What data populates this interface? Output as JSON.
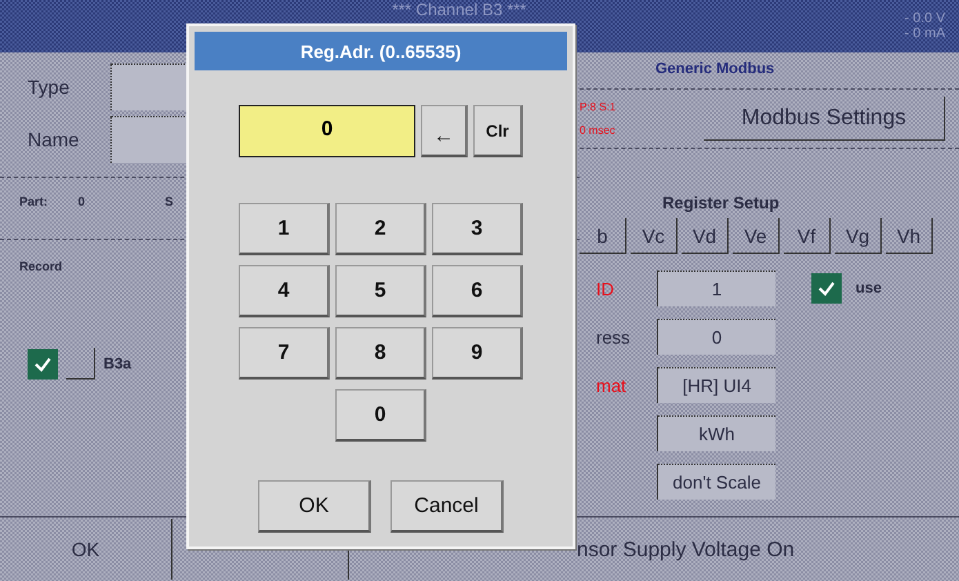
{
  "screen": {
    "title": "*** Channel B3 ***",
    "readings": [
      "- 0.0 V",
      "- 0 mA"
    ],
    "type_label": "Type",
    "name_label": "Name",
    "part_label": "Part:",
    "part_value": "0",
    "part_cut": "S",
    "record_label": "Record",
    "record_channel": {
      "label": "B3a",
      "checked": true
    },
    "sensor_type": "Generic Modbus",
    "info_lines": [
      "P:8 S:1",
      "0 msec"
    ],
    "modbus_settings": "Modbus Settings",
    "register_setup": "Register Setup",
    "register_tabs": [
      "b",
      "Vc",
      "Vd",
      "Ve",
      "Vf",
      "Vg",
      "Vh"
    ],
    "fields": [
      {
        "label": "ID",
        "highlighted": true,
        "value": "1"
      },
      {
        "label": "ress",
        "highlighted": false,
        "value": "0"
      },
      {
        "label": "mat",
        "highlighted": true,
        "value": "[HR] UI4"
      },
      {
        "value": "kWh"
      },
      {
        "value": "don't Scale"
      }
    ],
    "use": {
      "label": "use",
      "checked": true
    },
    "bottom": {
      "ok": "OK",
      "sensor_supply": "nsor Supply Voltage On"
    }
  },
  "dialog": {
    "title": "Reg.Adr. (0..65535)",
    "value": "0",
    "backspace": "←",
    "clear": "Clr",
    "keys": [
      "1",
      "2",
      "3",
      "4",
      "5",
      "6",
      "7",
      "8",
      "9",
      "0"
    ],
    "buttons": [
      "OK",
      "Cancel"
    ]
  }
}
